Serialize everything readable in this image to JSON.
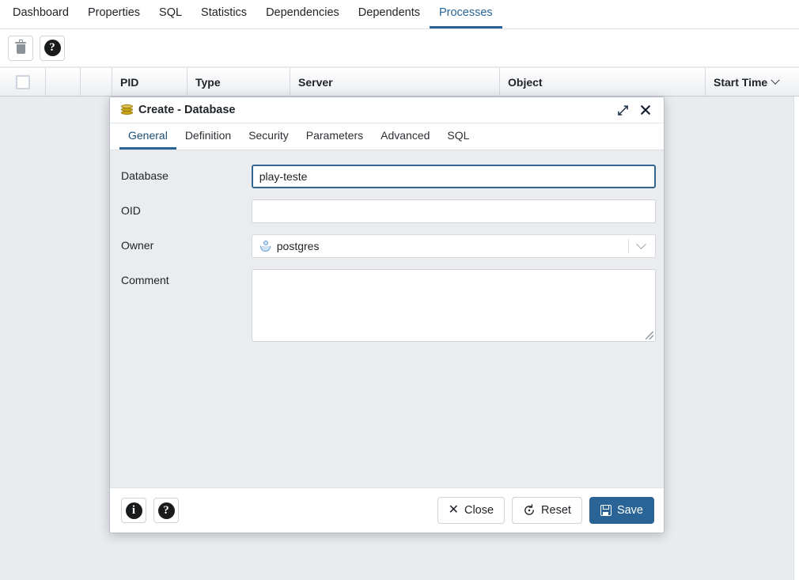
{
  "top_tabs": [
    {
      "label": "Dashboard",
      "active": false
    },
    {
      "label": "Properties",
      "active": false
    },
    {
      "label": "SQL",
      "active": false
    },
    {
      "label": "Statistics",
      "active": false
    },
    {
      "label": "Dependencies",
      "active": false
    },
    {
      "label": "Dependents",
      "active": false
    },
    {
      "label": "Processes",
      "active": true
    }
  ],
  "toolbar": {
    "delete_icon": "trash-icon",
    "help_icon": "question-mark-icon",
    "help_glyph": "?"
  },
  "grid": {
    "columns": [
      "PID",
      "Type",
      "Server",
      "Object",
      "Start Time"
    ],
    "sort_column": "Start Time",
    "sort_indicator": "chevron-down-icon"
  },
  "dialog": {
    "title": "Create - Database",
    "title_icon": "database-icon",
    "maximize_icon": "maximize-icon",
    "close_icon": "close-icon",
    "tabs": [
      {
        "label": "General",
        "active": true
      },
      {
        "label": "Definition",
        "active": false
      },
      {
        "label": "Security",
        "active": false
      },
      {
        "label": "Parameters",
        "active": false
      },
      {
        "label": "Advanced",
        "active": false
      },
      {
        "label": "SQL",
        "active": false
      }
    ],
    "fields": {
      "database": {
        "label": "Database",
        "value": "play-teste",
        "focused": true
      },
      "oid": {
        "label": "OID",
        "value": ""
      },
      "owner": {
        "label": "Owner",
        "value": "postgres",
        "icon": "user-icon",
        "caret": "chevron-down-icon"
      },
      "comment": {
        "label": "Comment",
        "value": ""
      }
    },
    "footer": {
      "info_glyph": "i",
      "info_icon": "info-circle-icon",
      "help_glyph": "?",
      "help_icon": "question-circle-icon",
      "close_label": "Close",
      "close_icon": "x-icon",
      "reset_label": "Reset",
      "reset_icon": "reset-circle-arrow-icon",
      "save_label": "Save",
      "save_icon": "floppy-disk-icon"
    }
  },
  "colors": {
    "accent": "#2a6496",
    "dialog_bg": "#eaecef",
    "page_bg": "#e9ecef",
    "db_icon": "#c8a317"
  }
}
